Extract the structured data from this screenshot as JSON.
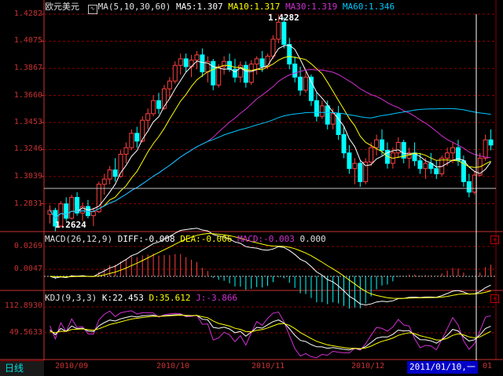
{
  "title": "欧元美元",
  "colors": {
    "background": "#000000",
    "grid": "#8b0000",
    "axis_text": "#c83232",
    "up": "#ff4040",
    "down": "#00ffff",
    "ma5": "#ffffff",
    "ma10": "#ffff00",
    "ma30": "#d030d0",
    "ma60": "#00c8ff",
    "k": "#ffffff",
    "d": "#ffff00",
    "j": "#d030d0"
  },
  "main_panel": {
    "ma_label": "MA(5,10,30,60)",
    "ma5": "MA5:1.307",
    "ma10": "MA10:1.317",
    "ma30": "MA30:1.319",
    "ma60": "MA60:1.346",
    "high_marker": "1.4282",
    "low_marker": "1.2624",
    "y_labels": [
      "1.4282",
      "1.4075",
      "1.3867",
      "1.3660",
      "1.3453",
      "1.3246",
      "1.3039",
      "1.2831"
    ]
  },
  "macd_panel": {
    "label": "MACD(26,12,9)",
    "diff": "DIFF:-0.008",
    "dea": "DEA:-0.006",
    "macd": "MACD:-0.003",
    "extra": "0.000",
    "y_labels": [
      "0.0269",
      "0.0047"
    ],
    "button": "+"
  },
  "kdj_panel": {
    "label": "KDJ(9,3,3)",
    "k": "K:22.453",
    "d": "D:35.612",
    "j": "J:-3.866",
    "y_labels": [
      "112.8930",
      "49.5633"
    ],
    "button": "+"
  },
  "timebar": {
    "period_tab": "日线",
    "dates": [
      "2010/09",
      "2010/10",
      "2010/11",
      "2010/12",
      "01"
    ],
    "cursor_date": "2011/01/10,一"
  },
  "chart_data": {
    "type": "candlestick",
    "ylim": [
      1.2624,
      1.4282
    ],
    "candles": [
      [
        1.275,
        1.282,
        1.268,
        1.278
      ],
      [
        1.278,
        1.28,
        1.262,
        1.266
      ],
      [
        1.266,
        1.285,
        1.265,
        1.283
      ],
      [
        1.283,
        1.288,
        1.27,
        1.272
      ],
      [
        1.272,
        1.29,
        1.271,
        1.288
      ],
      [
        1.288,
        1.292,
        1.274,
        1.276
      ],
      [
        1.276,
        1.284,
        1.27,
        1.281
      ],
      [
        1.281,
        1.286,
        1.272,
        1.274
      ],
      [
        1.274,
        1.28,
        1.266,
        1.277
      ],
      [
        1.277,
        1.3,
        1.276,
        1.298
      ],
      [
        1.298,
        1.306,
        1.29,
        1.302
      ],
      [
        1.302,
        1.312,
        1.298,
        1.309
      ],
      [
        1.309,
        1.318,
        1.3,
        1.304
      ],
      [
        1.304,
        1.324,
        1.303,
        1.321
      ],
      [
        1.321,
        1.33,
        1.314,
        1.326
      ],
      [
        1.326,
        1.34,
        1.324,
        1.337
      ],
      [
        1.337,
        1.342,
        1.326,
        1.331
      ],
      [
        1.331,
        1.35,
        1.33,
        1.347
      ],
      [
        1.347,
        1.356,
        1.34,
        1.352
      ],
      [
        1.352,
        1.366,
        1.35,
        1.362
      ],
      [
        1.362,
        1.368,
        1.352,
        1.356
      ],
      [
        1.356,
        1.374,
        1.355,
        1.371
      ],
      [
        1.371,
        1.38,
        1.364,
        1.377
      ],
      [
        1.377,
        1.392,
        1.375,
        1.389
      ],
      [
        1.389,
        1.398,
        1.382,
        1.394
      ],
      [
        1.394,
        1.398,
        1.384,
        1.388
      ],
      [
        1.388,
        1.397,
        1.38,
        1.393
      ],
      [
        1.393,
        1.4,
        1.386,
        1.397
      ],
      [
        1.397,
        1.402,
        1.38,
        1.384
      ],
      [
        1.384,
        1.396,
        1.376,
        1.392
      ],
      [
        1.392,
        1.394,
        1.37,
        1.374
      ],
      [
        1.374,
        1.39,
        1.372,
        1.388
      ],
      [
        1.388,
        1.396,
        1.382,
        1.392
      ],
      [
        1.392,
        1.398,
        1.384,
        1.386
      ],
      [
        1.386,
        1.394,
        1.376,
        1.38
      ],
      [
        1.38,
        1.392,
        1.376,
        1.389
      ],
      [
        1.389,
        1.392,
        1.372,
        1.376
      ],
      [
        1.376,
        1.393,
        1.374,
        1.39
      ],
      [
        1.39,
        1.396,
        1.382,
        1.394
      ],
      [
        1.394,
        1.4,
        1.384,
        1.388
      ],
      [
        1.388,
        1.398,
        1.386,
        1.396
      ],
      [
        1.396,
        1.412,
        1.394,
        1.409
      ],
      [
        1.409,
        1.428,
        1.406,
        1.422
      ],
      [
        1.422,
        1.426,
        1.402,
        1.405
      ],
      [
        1.405,
        1.41,
        1.386,
        1.39
      ],
      [
        1.39,
        1.396,
        1.376,
        1.38
      ],
      [
        1.38,
        1.388,
        1.366,
        1.37
      ],
      [
        1.37,
        1.384,
        1.368,
        1.38
      ],
      [
        1.38,
        1.382,
        1.358,
        1.362
      ],
      [
        1.362,
        1.368,
        1.346,
        1.35
      ],
      [
        1.35,
        1.362,
        1.348,
        1.358
      ],
      [
        1.358,
        1.362,
        1.34,
        1.344
      ],
      [
        1.344,
        1.356,
        1.34,
        1.352
      ],
      [
        1.352,
        1.358,
        1.332,
        1.336
      ],
      [
        1.336,
        1.342,
        1.318,
        1.322
      ],
      [
        1.322,
        1.328,
        1.306,
        1.31
      ],
      [
        1.31,
        1.318,
        1.298,
        1.314
      ],
      [
        1.314,
        1.316,
        1.296,
        1.3
      ],
      [
        1.3,
        1.318,
        1.298,
        1.315
      ],
      [
        1.315,
        1.33,
        1.312,
        1.326
      ],
      [
        1.326,
        1.336,
        1.32,
        1.332
      ],
      [
        1.332,
        1.34,
        1.32,
        1.324
      ],
      [
        1.324,
        1.33,
        1.31,
        1.314
      ],
      [
        1.314,
        1.326,
        1.31,
        1.322
      ],
      [
        1.322,
        1.334,
        1.318,
        1.33
      ],
      [
        1.33,
        1.332,
        1.314,
        1.318
      ],
      [
        1.318,
        1.326,
        1.31,
        1.322
      ],
      [
        1.322,
        1.33,
        1.312,
        1.316
      ],
      [
        1.316,
        1.322,
        1.306,
        1.31
      ],
      [
        1.31,
        1.318,
        1.302,
        1.314
      ],
      [
        1.314,
        1.322,
        1.306,
        1.31
      ],
      [
        1.31,
        1.316,
        1.302,
        1.306
      ],
      [
        1.306,
        1.32,
        1.304,
        1.318
      ],
      [
        1.318,
        1.326,
        1.312,
        1.322
      ],
      [
        1.322,
        1.33,
        1.314,
        1.326
      ],
      [
        1.326,
        1.332,
        1.312,
        1.316
      ],
      [
        1.316,
        1.32,
        1.296,
        1.3
      ],
      [
        1.3,
        1.306,
        1.288,
        1.292
      ],
      [
        1.292,
        1.308,
        1.29,
        1.305
      ],
      [
        1.305,
        1.322,
        1.304,
        1.318
      ],
      [
        1.318,
        1.336,
        1.316,
        1.332
      ],
      [
        1.332,
        1.34,
        1.324,
        1.328
      ]
    ]
  }
}
